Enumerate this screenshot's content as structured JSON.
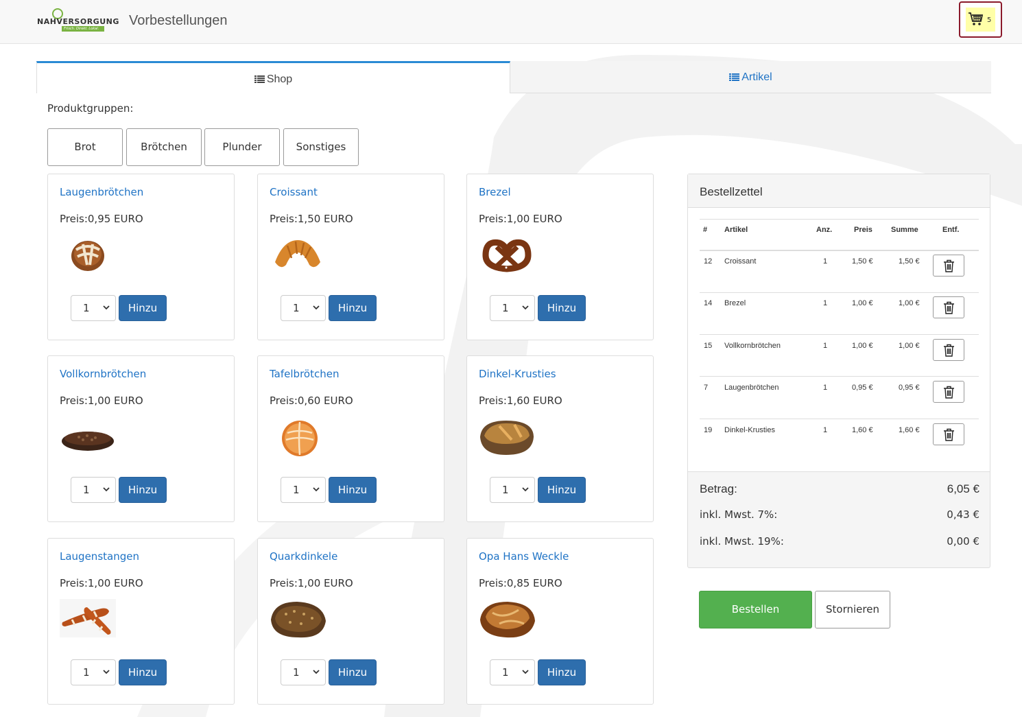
{
  "header": {
    "logo_text": "NAHVERSORGUNG",
    "logo_tagline": "Frisch. Direkt. Lokal.",
    "title": "Vorbestellungen",
    "cart_count": "5"
  },
  "tabs": [
    {
      "label": "Shop",
      "icon": "list-icon",
      "active": true
    },
    {
      "label": "Artikel",
      "icon": "list-icon",
      "active": false
    }
  ],
  "groups": {
    "label": "Produktgruppen:",
    "items": [
      "Brot",
      "Brötchen",
      "Plunder",
      "Sonstiges"
    ]
  },
  "products": [
    {
      "name": "Laugenbrötchen",
      "price": "Preis:0,95 EURO",
      "qty": "1",
      "add": "Hinzu",
      "image": "laugenbroetchen"
    },
    {
      "name": "Croissant",
      "price": "Preis:1,50 EURO",
      "qty": "1",
      "add": "Hinzu",
      "image": "croissant"
    },
    {
      "name": "Brezel",
      "price": "Preis:1,00 EURO",
      "qty": "1",
      "add": "Hinzu",
      "image": "brezel"
    },
    {
      "name": "Vollkornbrötchen",
      "price": "Preis:1,00 EURO",
      "qty": "1",
      "add": "Hinzu",
      "image": "vollkornbroetchen"
    },
    {
      "name": "Tafelbrötchen",
      "price": "Preis:0,60 EURO",
      "qty": "1",
      "add": "Hinzu",
      "image": "tafelbroetchen"
    },
    {
      "name": "Dinkel-Krusties",
      "price": "Preis:1,60 EURO",
      "qty": "1",
      "add": "Hinzu",
      "image": "dinkel-krusties"
    },
    {
      "name": "Laugenstangen",
      "price": "Preis:1,00 EURO",
      "qty": "1",
      "add": "Hinzu",
      "image": "laugenstangen"
    },
    {
      "name": "Quarkdinkele",
      "price": "Preis:1,00 EURO",
      "qty": "1",
      "add": "Hinzu",
      "image": "quarkdinkele"
    },
    {
      "name": "Opa Hans Weckle",
      "price": "Preis:0,85 EURO",
      "qty": "1",
      "add": "Hinzu",
      "image": "opa-hans-weckle"
    }
  ],
  "order": {
    "title": "Bestellzettel",
    "columns": [
      "#",
      "Artikel",
      "Anz.",
      "Preis",
      "Summe",
      "Entf."
    ],
    "rows": [
      {
        "id": "12",
        "article": "Croissant",
        "qty": "1",
        "price": "1,50 €",
        "sum": "1,50 €"
      },
      {
        "id": "14",
        "article": "Brezel",
        "qty": "1",
        "price": "1,00 €",
        "sum": "1,00 €"
      },
      {
        "id": "15",
        "article": "Vollkornbrötchen",
        "qty": "1",
        "price": "1,00 €",
        "sum": "1,00 €"
      },
      {
        "id": "7",
        "article": "Laugenbrötchen",
        "qty": "1",
        "price": "0,95 €",
        "sum": "0,95 €"
      },
      {
        "id": "19",
        "article": "Dinkel-Krusties",
        "qty": "1",
        "price": "1,60 €",
        "sum": "1,60 €"
      }
    ],
    "total_label": "Betrag:",
    "total_value": "6,05 €",
    "vat7_label": "inkl. Mwst. 7%:",
    "vat7_value": "0,43 €",
    "vat19_label": "inkl. Mwst. 19%:",
    "vat19_value": "0,00 €"
  },
  "actions": {
    "order": "Bestellen",
    "cancel": "Stornieren"
  },
  "colors": {
    "link": "#1f73c5",
    "primary_button": "#2e6ead",
    "success_button": "#53b04f",
    "cart_border": "#8b1a2b",
    "cart_highlight": "#ffffa8",
    "tab_accent": "#2a8ad4"
  }
}
